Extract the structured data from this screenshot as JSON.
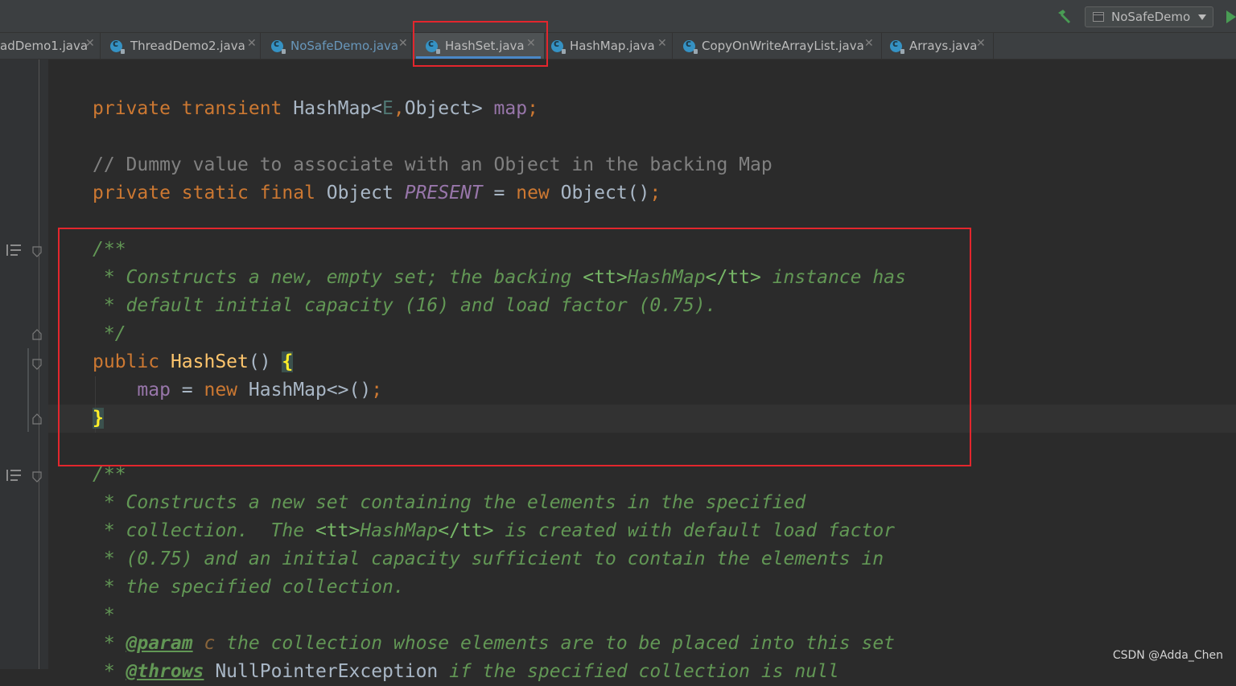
{
  "toolbar": {
    "run_config": "NoSafeDemo",
    "build_icon": "hammer-icon",
    "run_icon": "play-icon"
  },
  "tabs": [
    {
      "label": "adDemo1.java",
      "active": false
    },
    {
      "label": "ThreadDemo2.java",
      "active": false
    },
    {
      "label": "NoSafeDemo.java",
      "active": false,
      "modified": true
    },
    {
      "label": "HashSet.java",
      "active": true
    },
    {
      "label": "HashMap.java",
      "active": false
    },
    {
      "label": "CopyOnWriteArrayList.java",
      "active": false
    },
    {
      "label": "Arrays.java",
      "active": false
    }
  ],
  "editor": {
    "lines": [
      {
        "tokens": [
          {
            "t": "kw",
            "s": "private transient "
          },
          {
            "t": "plain",
            "s": "HashMap<"
          },
          {
            "t": "type-param",
            "s": "E"
          },
          {
            "t": "kw",
            "s": ","
          },
          {
            "t": "plain",
            "s": "Object> "
          },
          {
            "t": "field",
            "s": "map"
          },
          {
            "t": "kw",
            "s": ";"
          }
        ]
      },
      {
        "tokens": []
      },
      {
        "tokens": [
          {
            "t": "cm",
            "s": "// Dummy value to associate with an Object in the backing Map"
          }
        ]
      },
      {
        "tokens": [
          {
            "t": "kw",
            "s": "private static final "
          },
          {
            "t": "plain",
            "s": "Object "
          },
          {
            "t": "static-field",
            "s": "PRESENT"
          },
          {
            "t": "plain",
            "s": " = "
          },
          {
            "t": "kw",
            "s": "new "
          },
          {
            "t": "plain",
            "s": "Object()"
          },
          {
            "t": "kw",
            "s": ";"
          }
        ]
      },
      {
        "tokens": []
      },
      {
        "tokens": [
          {
            "t": "doc",
            "s": "/**"
          }
        ]
      },
      {
        "tokens": [
          {
            "t": "doc",
            "s": " * Constructs a new, empty set; the backing "
          },
          {
            "t": "doctag",
            "s": "<tt>"
          },
          {
            "t": "doc",
            "s": "HashMap"
          },
          {
            "t": "doctag",
            "s": "</tt>"
          },
          {
            "t": "doc",
            "s": " instance has"
          }
        ]
      },
      {
        "tokens": [
          {
            "t": "doc",
            "s": " * default initial capacity (16) and load factor (0.75)."
          }
        ]
      },
      {
        "tokens": [
          {
            "t": "doc",
            "s": " */"
          }
        ]
      },
      {
        "tokens": [
          {
            "t": "kw",
            "s": "public "
          },
          {
            "t": "method-decl",
            "s": "HashSet"
          },
          {
            "t": "plain",
            "s": "() "
          },
          {
            "t": "brace-match",
            "s": "{"
          }
        ]
      },
      {
        "tokens": [
          {
            "t": "plain",
            "s": "    "
          },
          {
            "t": "field",
            "s": "map"
          },
          {
            "t": "plain",
            "s": " = "
          },
          {
            "t": "kw",
            "s": "new "
          },
          {
            "t": "plain",
            "s": "HashMap<>()"
          },
          {
            "t": "kw",
            "s": ";"
          }
        ]
      },
      {
        "tokens": [
          {
            "t": "brace-match",
            "s": "}"
          }
        ]
      },
      {
        "tokens": []
      },
      {
        "tokens": [
          {
            "t": "doc",
            "s": "/**"
          }
        ]
      },
      {
        "tokens": [
          {
            "t": "doc",
            "s": " * Constructs a new set containing the elements in the specified"
          }
        ]
      },
      {
        "tokens": [
          {
            "t": "doc",
            "s": " * collection.  The "
          },
          {
            "t": "doctag",
            "s": "<tt>"
          },
          {
            "t": "doc",
            "s": "HashMap"
          },
          {
            "t": "doctag",
            "s": "</tt>"
          },
          {
            "t": "doc",
            "s": " is created with default load factor"
          }
        ]
      },
      {
        "tokens": [
          {
            "t": "doc",
            "s": " * (0.75) and an initial capacity sufficient to contain the elements in"
          }
        ]
      },
      {
        "tokens": [
          {
            "t": "doc",
            "s": " * the specified collection."
          }
        ]
      },
      {
        "tokens": [
          {
            "t": "doc",
            "s": " *"
          }
        ]
      },
      {
        "tokens": [
          {
            "t": "doc",
            "s": " * "
          },
          {
            "t": "docparam",
            "s": "@param"
          },
          {
            "t": "docvar",
            "s": " c"
          },
          {
            "t": "doc",
            "s": " the collection whose elements are to be placed into this set"
          }
        ]
      },
      {
        "tokens": [
          {
            "t": "doc",
            "s": " * "
          },
          {
            "t": "docparam",
            "s": "@throws"
          },
          {
            "t": "plain",
            "s": " NullPointerException"
          },
          {
            "t": "doc",
            "s": " if the specified collection is null"
          }
        ]
      }
    ]
  },
  "watermark": "CSDN @Adda_Chen"
}
